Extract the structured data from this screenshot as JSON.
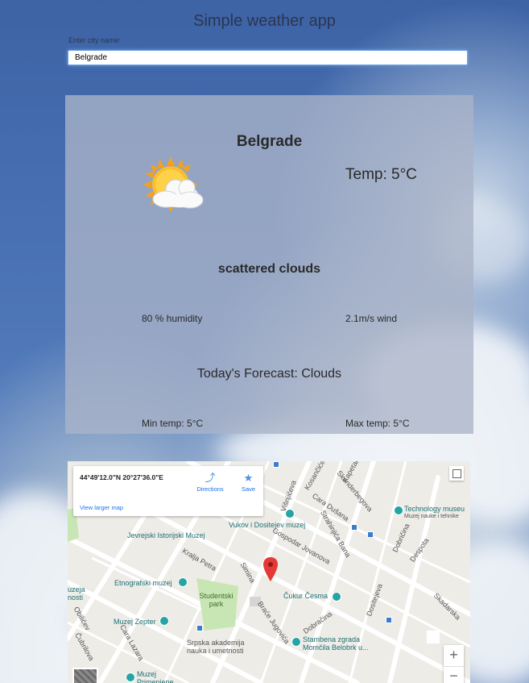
{
  "app": {
    "title": "Simple weather app"
  },
  "search": {
    "label": "Enter city name:",
    "value": "Belgrade"
  },
  "weather": {
    "city": "Belgrade",
    "icon": "partly-cloudy-sun-icon",
    "temp": "Temp: 5°C",
    "description": "scattered clouds",
    "humidity": "80 % humidity",
    "wind": "2.1m/s wind",
    "forecast": "Today's Forecast: Clouds",
    "min_temp": "Min temp: 5°C",
    "max_temp": "Max temp: 5°C"
  },
  "map": {
    "coordinates": "44°49'12.0\"N 20°27'36.0\"E",
    "directions_label": "Directions",
    "save_label": "Save",
    "larger_map_label": "View larger map",
    "zoom_in": "+",
    "zoom_out": "−",
    "places": {
      "technology_museum": "Technology museu",
      "technology_museum_sub": "Muzej nauke i tehnike",
      "vukov": "Vukov i Dositejev muzej",
      "jevrejski": "Jevrejski Istorijski Muzej",
      "etnografski": "Etnografski muzej",
      "studentski": "Studentski park",
      "cukur": "Čukur Česma",
      "zepter": "Muzej Zepter",
      "sanu": "Srpska akademija nauka i umetnosti",
      "stambena": "Stambena zgrada Momčila Belobrk u...",
      "primenjene": "Muzej Primenjene umetnosti",
      "muzeja": "uzeja",
      "nosti": "nosti"
    },
    "streets": {
      "cara_dusana": "Cara Dušana",
      "kralja_petra": "Kralja Petra",
      "gospodar_jovanova": "Gospodar Jovanova",
      "strahinjica_bana": "Strahinjića Bana",
      "simina": "Simina",
      "dobracina": "Dobračina",
      "brace_jugovica": "Braće Jugovića",
      "dositejeva": "Dositejeva",
      "skenderbegova": "Skenderbegova",
      "dobricina": "Dobričina",
      "despota": "Despota",
      "visnjiceva": "Višnjićeva",
      "kosancicev": "Kosančićev",
      "skadarska": "Skadarska",
      "kapetan": "Kapetan",
      "cubrilova": "Čubrilova",
      "cara_lazara": "Cara Lazara",
      "obilicev": "Obilićev"
    }
  }
}
